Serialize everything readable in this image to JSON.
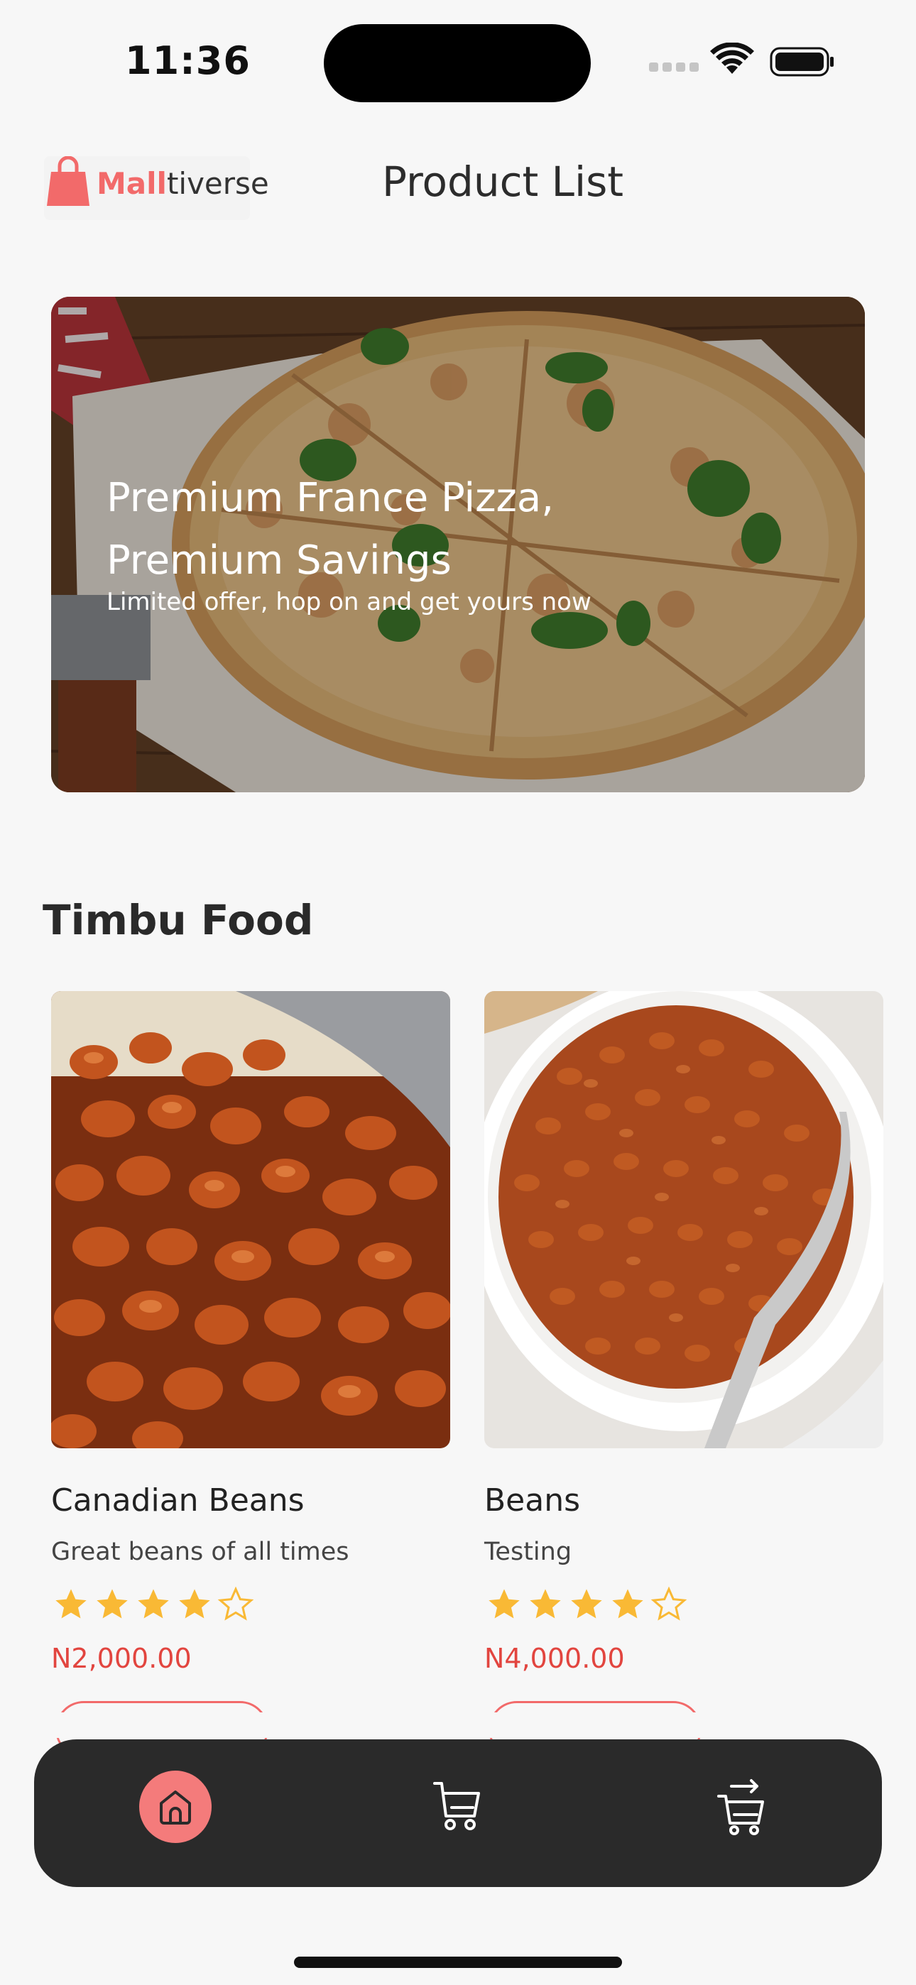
{
  "status_bar": {
    "time": "11:36"
  },
  "header": {
    "logo_brand_part1": "Mall",
    "logo_brand_part2": "tiverse",
    "title": "Product List"
  },
  "banner": {
    "title": "Premium France Pizza, Premium Savings",
    "subtitle": "Limited offer, hop on and get yours now"
  },
  "section": {
    "title": "Timbu Food"
  },
  "products": [
    {
      "name": "Canadian Beans",
      "description": "Great beans of all times",
      "rating": 4,
      "rating_max": 5,
      "price": "N2,000.00"
    },
    {
      "name": "Beans",
      "description": "Testing",
      "rating": 4,
      "rating_max": 5,
      "price": "N4,000.00"
    }
  ],
  "bottom_nav": {
    "items": [
      {
        "icon": "home-icon",
        "active": true
      },
      {
        "icon": "cart-icon",
        "active": false
      },
      {
        "icon": "checkout-cart-icon",
        "active": false
      }
    ]
  },
  "colors": {
    "accent": "#f26a6a",
    "price": "#e2453f",
    "star": "#f9b935",
    "nav_bg": "#2a2a2a"
  }
}
